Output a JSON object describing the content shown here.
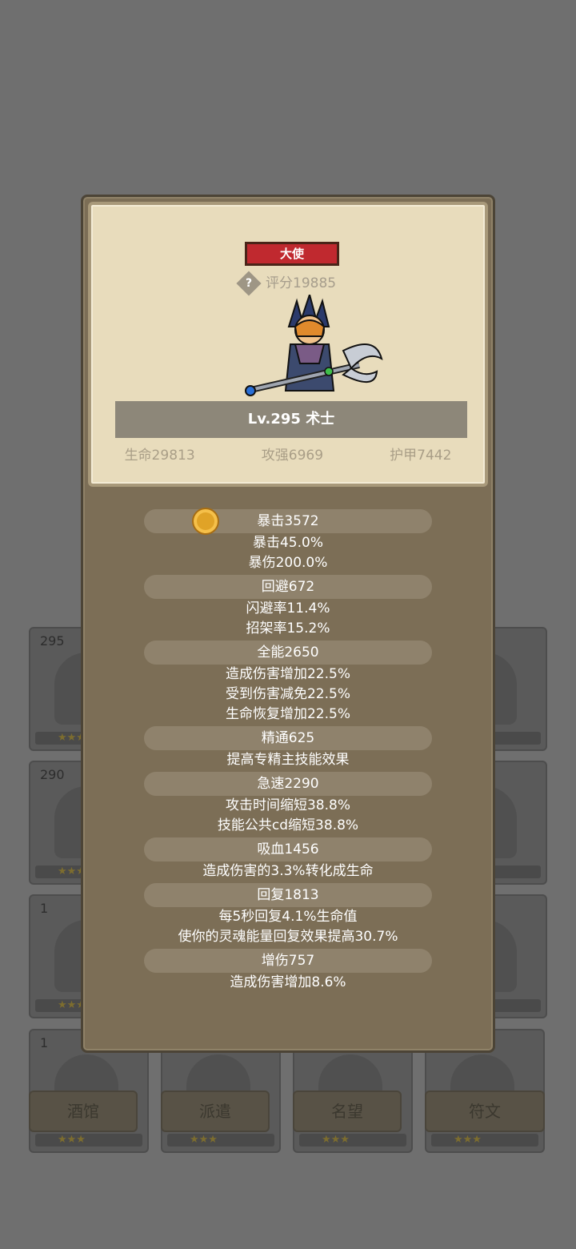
{
  "background": {
    "cards": [
      {
        "level": "295"
      },
      {
        "level": ""
      },
      {
        "level": "290"
      },
      {
        "level": ""
      },
      {
        "level": "1"
      },
      {
        "level": ""
      },
      {
        "level": "1"
      },
      {
        "level": ""
      },
      {
        "level": ""
      },
      {
        "level": ""
      }
    ],
    "bottom_buttons": [
      "酒馆",
      "派遣",
      "名望",
      "符文"
    ],
    "stars": "★★★"
  },
  "popup": {
    "title_tag": "大使",
    "help_icon": "?",
    "score": "评分19885",
    "name": "Lv.295 术士",
    "base_stats": {
      "hp": "生命29813",
      "atk": "攻强6969",
      "armor": "护甲7442"
    },
    "stat_groups": [
      {
        "title": "暴击3572",
        "lines": [
          "暴击45.0%",
          "暴伤200.0%"
        ]
      },
      {
        "title": "回避672",
        "lines": [
          "闪避率11.4%",
          "招架率15.2%"
        ]
      },
      {
        "title": "全能2650",
        "lines": [
          "造成伤害增加22.5%",
          "受到伤害减免22.5%",
          "生命恢复增加22.5%"
        ]
      },
      {
        "title": "精通625",
        "lines": [
          "提高专精主技能效果"
        ]
      },
      {
        "title": "急速2290",
        "lines": [
          "攻击时间缩短38.8%",
          "技能公共cd缩短38.8%"
        ]
      },
      {
        "title": "吸血1456",
        "lines": [
          "造成伤害的3.3%转化成生命"
        ]
      },
      {
        "title": "回复1813",
        "lines": [
          "每5秒回复4.1%生命值",
          "使你的灵魂能量回复效果提高30.7%"
        ]
      },
      {
        "title": "增伤757",
        "lines": [
          "造成伤害增加8.6%"
        ]
      }
    ]
  }
}
